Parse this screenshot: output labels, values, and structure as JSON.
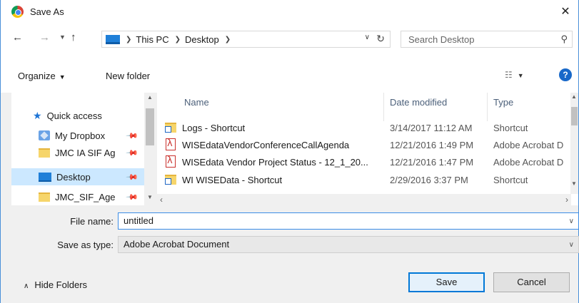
{
  "window": {
    "title": "Save As"
  },
  "address": {
    "crumbs": [
      "This PC",
      "Desktop"
    ]
  },
  "search": {
    "placeholder": "Search Desktop"
  },
  "toolbar": {
    "organize": "Organize",
    "new_folder": "New folder"
  },
  "navpane": {
    "items": [
      {
        "label": "Quick access"
      },
      {
        "label": "My Dropbox"
      },
      {
        "label": "JMC IA SIF Ag"
      },
      {
        "label": "Desktop"
      },
      {
        "label": "JMC_SIF_Age"
      }
    ]
  },
  "filelist": {
    "columns": [
      "Name",
      "Date modified",
      "Type"
    ],
    "rows": [
      {
        "name": "Logs - Shortcut",
        "date": "3/14/2017 11:12 AM",
        "type": "Shortcut",
        "icon": "shortcut-icon"
      },
      {
        "name": "WISEdataVendorConferenceCallAgenda",
        "date": "12/21/2016 1:49 PM",
        "type": "Adobe Acrobat D",
        "icon": "pdf-icon"
      },
      {
        "name": "WISEdata Vendor Project Status - 12_1_20...",
        "date": "12/21/2016 1:47 PM",
        "type": "Adobe Acrobat D",
        "icon": "pdf-icon"
      },
      {
        "name": "WI WISEData - Shortcut",
        "date": "2/29/2016 3:37 PM",
        "type": "Shortcut",
        "icon": "shortcut-icon"
      }
    ]
  },
  "form": {
    "filename_label": "File name:",
    "filename_value": "untitled",
    "savetype_label": "Save as type:",
    "savetype_value": "Adobe Acrobat Document"
  },
  "footer": {
    "hide_folders": "Hide Folders",
    "save": "Save",
    "cancel": "Cancel"
  },
  "colors": {
    "selection": "#cce8ff",
    "accent": "#0078d7",
    "help": "#1868c9"
  }
}
